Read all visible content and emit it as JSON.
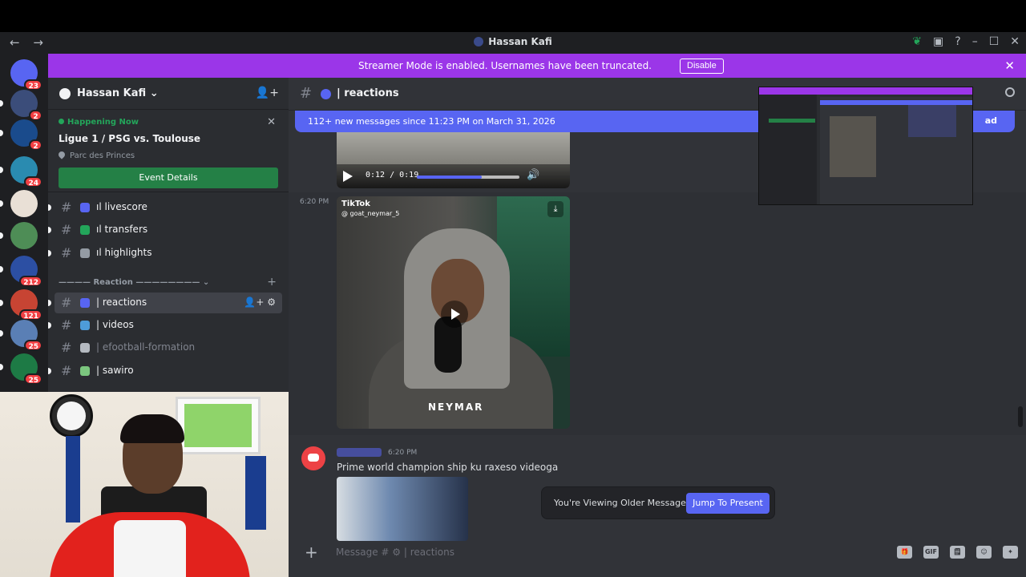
{
  "window": {
    "title": "Hassan Kafi",
    "nav_back": "←",
    "nav_forward": "→",
    "controls": [
      "–",
      "☐",
      "✕"
    ]
  },
  "streamer_banner": {
    "text": "Streamer Mode is enabled. Usernames have been truncated.",
    "disable_label": "Disable",
    "close_label": "✕",
    "color": "#9b36e8"
  },
  "servers": [
    {
      "badge": "23",
      "color": "#5865f2"
    },
    {
      "badge": "2",
      "color": "#3b4d7a"
    },
    {
      "badge": "2",
      "color": "#1a4b8c"
    },
    {
      "badge": "24",
      "color": "#2a8bb0"
    },
    {
      "badge": "",
      "color": "#e9e0d6"
    },
    {
      "badge": "",
      "color": "#4e8d56"
    },
    {
      "badge": "212",
      "color": "#2c4fa3"
    },
    {
      "badge": "121",
      "color": "#c74433"
    },
    {
      "badge": "25",
      "color": "#5a7fb5"
    },
    {
      "badge": "25",
      "color": "#1d7a45"
    }
  ],
  "guild": {
    "name": "Hassan Kafi",
    "chevron": "⌄",
    "add_member": "👤+"
  },
  "event": {
    "status": "Happening Now",
    "name": "Ligue 1 / PSG vs. Toulouse",
    "location": "Parc des Princes",
    "button": "Event Details",
    "close": "✕"
  },
  "channels": [
    {
      "label": "ıl livescore",
      "icon_color": "#5865f2",
      "unread": true,
      "active": false,
      "muted": false
    },
    {
      "label": "ıl transfers",
      "icon_color": "#23a55a",
      "unread": true,
      "active": false,
      "muted": false
    },
    {
      "label": "ıl highlights",
      "icon_color": "#949ba4",
      "unread": true,
      "active": false,
      "muted": false
    }
  ],
  "category": {
    "label": "———— Reaction ————————",
    "chevron": "⌄",
    "plus": "+"
  },
  "category_channels": [
    {
      "label": "| reactions",
      "icon_color": "#5865f2",
      "unread": true,
      "active": true,
      "muted": false,
      "actions": "👤+ ⚙"
    },
    {
      "label": "| videos",
      "icon_color": "#4e9cd9",
      "unread": true,
      "active": false,
      "muted": false,
      "actions": ""
    },
    {
      "label": "| efootball-formation",
      "icon_color": "#b5bac1",
      "unread": false,
      "active": false,
      "muted": true,
      "actions": ""
    },
    {
      "label": "| sawiro",
      "icon_color": "#7bc67e",
      "unread": true,
      "active": false,
      "muted": false,
      "actions": ""
    }
  ],
  "chat": {
    "channel_name": "| reactions",
    "new_messages": "112+ new messages since 11:23 PM on March 31, 2026",
    "mark_as_read": "ad",
    "video1": {
      "time": "0:12 / 0:19",
      "progress": 0.63
    },
    "message1_time": "6:20 PM",
    "video2": {
      "brand": "TikTok",
      "handle": "@ goat_neymar_5",
      "watermark": "NEYMAR",
      "download": "⤓"
    },
    "message2": {
      "time": "6:20 PM",
      "text": "Prime world champion ship ku raxeso videoga"
    },
    "older_notice": "You're Viewing Older Messages",
    "jump_button": "Jump To Present",
    "composer_placeholder": "Message # ⚙ | reactions",
    "composer_tools": [
      "🎁",
      "GIF",
      "🗒",
      "☺",
      "✦"
    ]
  }
}
